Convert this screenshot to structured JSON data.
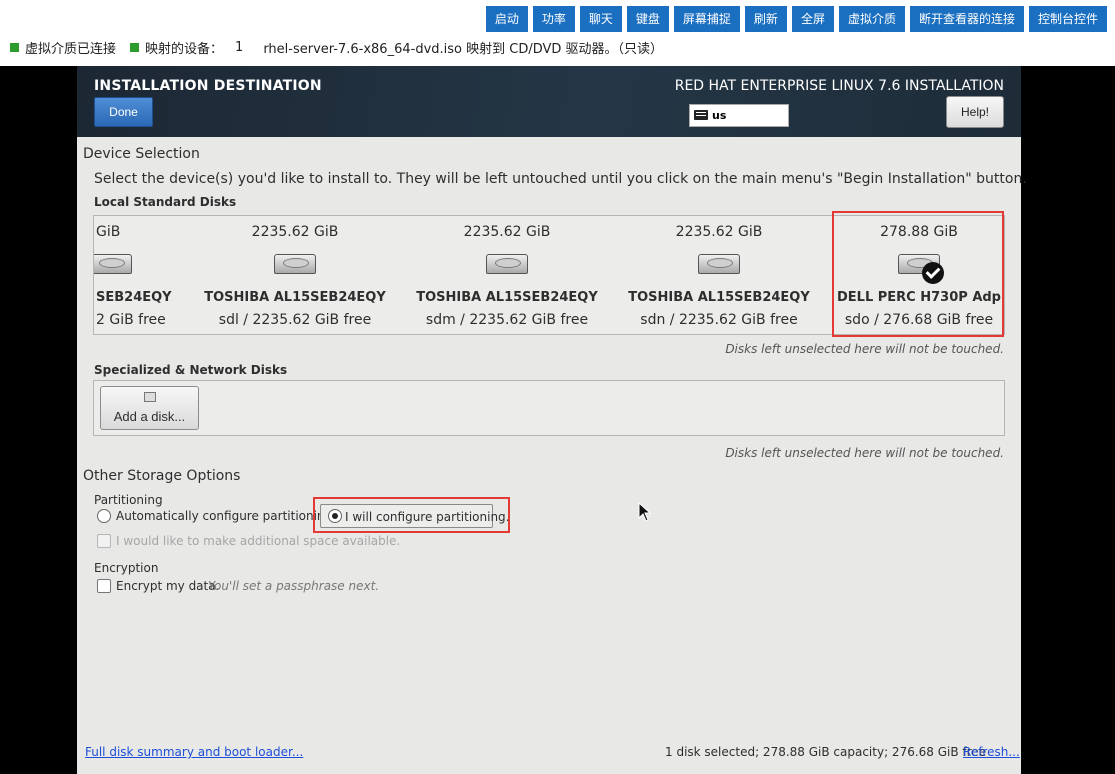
{
  "toolbar": {
    "buttons": [
      "启动",
      "功率",
      "聊天",
      "键盘",
      "屏幕捕捉",
      "刷新",
      "全屏",
      "虚拟介质",
      "断开查看器的连接",
      "控制台控件"
    ],
    "status_media": "虚拟介质已连接",
    "status_mapped_label": "映射的设备：",
    "status_mapped_count": "1",
    "status_mapped_text": "rhel-server-7.6-x86_64-dvd.iso 映射到 CD/DVD 驱动器。（只读）",
    "status_color": "#2c9d2c",
    "button_color": "#1b6fc0"
  },
  "header": {
    "title": "INSTALLATION DESTINATION",
    "done_label": "Done",
    "product": "RED HAT ENTERPRISE LINUX 7.6 INSTALLATION",
    "keyboard_layout": "us",
    "help_label": "Help!"
  },
  "device_selection": {
    "title": "Device Selection",
    "instructions": "Select the device(s) you'd like to install to.  They will be left untouched until you click on the main menu's \"Begin Installation\" button.",
    "local_title": "Local Standard Disks",
    "disks": [
      {
        "size": "GiB",
        "name": "SEB24EQY",
        "free": "2 GiB free",
        "selected": false
      },
      {
        "size": "2235.62 GiB",
        "name": "TOSHIBA AL15SEB24EQY",
        "free": "sdl  /  2235.62 GiB free",
        "selected": false
      },
      {
        "size": "2235.62 GiB",
        "name": "TOSHIBA AL15SEB24EQY",
        "free": "sdm  /  2235.62 GiB free",
        "selected": false
      },
      {
        "size": "2235.62 GiB",
        "name": "TOSHIBA AL15SEB24EQY",
        "free": "sdn  /  2235.62 GiB free",
        "selected": false
      },
      {
        "size": "278.88 GiB",
        "name": "DELL PERC H730P Adp",
        "free": "sdo  /  276.68 GiB free",
        "selected": true
      }
    ],
    "untouched_note": "Disks left unselected here will not be touched.",
    "special_title": "Specialized & Network Disks",
    "add_disk_label": "Add a disk...",
    "untouched_note_2": "Disks left unselected here will not be touched."
  },
  "other_storage": {
    "title": "Other Storage Options",
    "partitioning_title": "Partitioning",
    "auto_label": "Automatically configure partitioning.",
    "manual_label": "I will configure partitioning.",
    "space_label": "I would like to make additional space available.",
    "selected_option": "manual",
    "encryption_title": "Encryption",
    "encrypt_label": "Encrypt my data.",
    "encrypt_hint": "You'll set a passphrase next."
  },
  "footer": {
    "summary_link": "Full disk summary and boot loader...",
    "status": "1 disk selected; 278.88 GiB capacity; 276.68 GiB free",
    "refresh_link": "Refresh..."
  }
}
